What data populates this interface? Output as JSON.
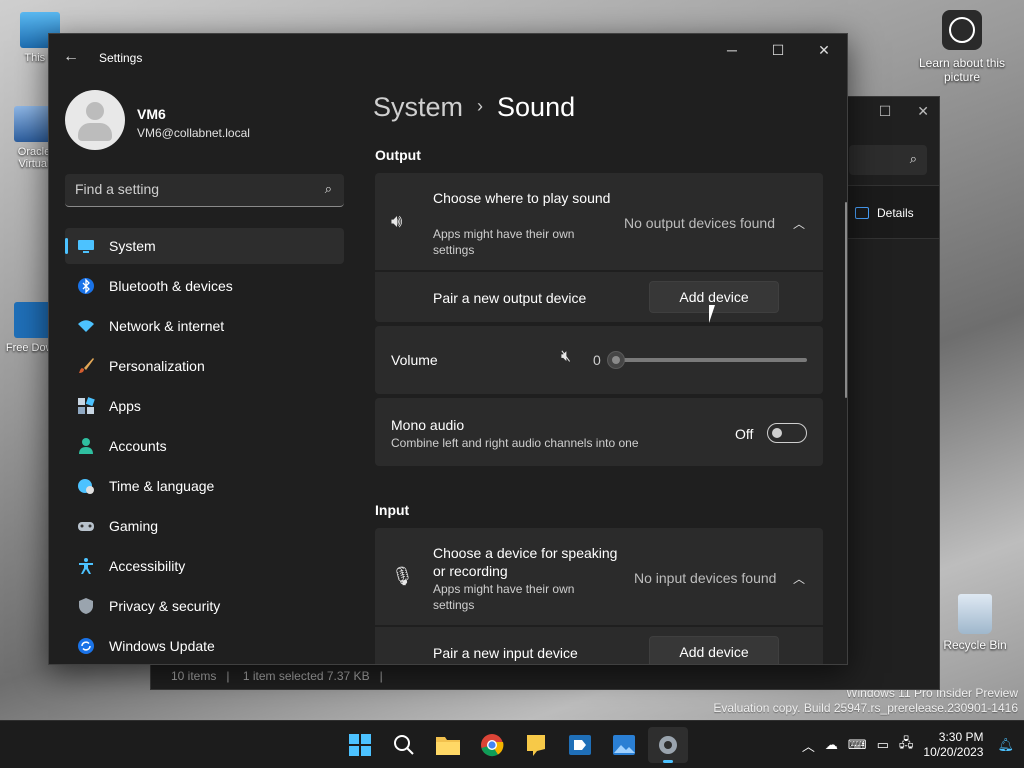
{
  "desktop": {
    "icons": [
      {
        "label": "This P"
      },
      {
        "label": "Oracle Virtual"
      },
      {
        "label": "Free Downl"
      }
    ],
    "learn_label": "Learn about this picture",
    "recycle_label": "Recycle Bin",
    "watermark_line1": "Windows 11 Pro Insider Preview",
    "watermark_line2": "Evaluation copy. Build 25947.rs_prerelease.230901-1416"
  },
  "explorer": {
    "details_label": "Details",
    "status_items": "10 items",
    "status_selected": "1 item selected  7.37 KB"
  },
  "settings": {
    "app_title": "Settings",
    "profile": {
      "name": "VM6",
      "email": "VM6@collabnet.local"
    },
    "search_placeholder": "Find a setting",
    "nav": [
      {
        "label": "System",
        "icon": "monitor-icon",
        "active": true
      },
      {
        "label": "Bluetooth & devices",
        "icon": "bluetooth-icon"
      },
      {
        "label": "Network & internet",
        "icon": "wifi-icon"
      },
      {
        "label": "Personalization",
        "icon": "brush-icon"
      },
      {
        "label": "Apps",
        "icon": "apps-icon"
      },
      {
        "label": "Accounts",
        "icon": "person-icon"
      },
      {
        "label": "Time & language",
        "icon": "globe-clock-icon"
      },
      {
        "label": "Gaming",
        "icon": "gamepad-icon"
      },
      {
        "label": "Accessibility",
        "icon": "accessibility-icon"
      },
      {
        "label": "Privacy & security",
        "icon": "shield-icon"
      },
      {
        "label": "Windows Update",
        "icon": "update-icon"
      }
    ],
    "breadcrumb": {
      "parent": "System",
      "current": "Sound"
    },
    "output": {
      "heading": "Output",
      "choose_title": "Choose where to play sound",
      "choose_sub": "Apps might have their own settings",
      "status": "No output devices found",
      "pair_label": "Pair a new output device",
      "add_button": "Add device"
    },
    "volume": {
      "label": "Volume",
      "value": "0",
      "level": 0
    },
    "mono": {
      "title": "Mono audio",
      "sub": "Combine left and right audio channels into one",
      "state": "Off"
    },
    "input": {
      "heading": "Input",
      "choose_title": "Choose a device for speaking or recording",
      "choose_sub": "Apps might have their own settings",
      "status": "No input devices found",
      "pair_label": "Pair a new input device",
      "add_button": "Add device"
    }
  },
  "taskbar": {
    "apps": [
      "start-icon",
      "search-icon",
      "file-explorer-icon",
      "chrome-icon",
      "notes-icon",
      "remote-app-icon",
      "photos-icon",
      "settings-icon"
    ],
    "time": "3:30 PM",
    "date": "10/20/2023"
  },
  "colors": {
    "accent": "#4cc2ff"
  }
}
